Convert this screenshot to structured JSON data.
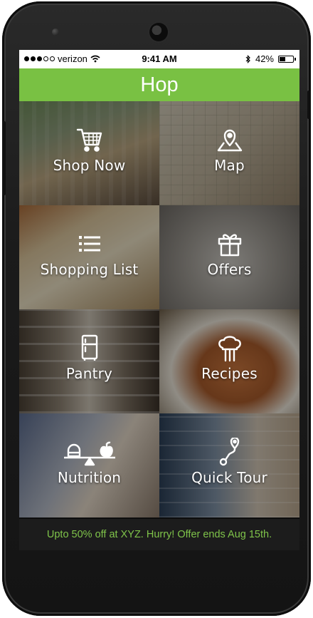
{
  "status_bar": {
    "carrier": "verizon",
    "signal_dots_filled": 3,
    "signal_dots_total": 5,
    "time": "9:41 AM",
    "battery_percent": "42%",
    "battery_level": 0.42
  },
  "header": {
    "title": "Hop"
  },
  "tiles": [
    {
      "label": "Shop Now",
      "icon": "shopping-cart-icon"
    },
    {
      "label": "Map",
      "icon": "map-pin-icon"
    },
    {
      "label": "Shopping List",
      "icon": "list-icon"
    },
    {
      "label": "Offers",
      "icon": "gift-icon"
    },
    {
      "label": "Pantry",
      "icon": "fridge-icon"
    },
    {
      "label": "Recipes",
      "icon": "chef-hat-icon"
    },
    {
      "label": "Nutrition",
      "icon": "balance-scale-icon"
    },
    {
      "label": "Quick Tour",
      "icon": "route-icon"
    }
  ],
  "promo": {
    "text": "Upto 50% off at XYZ. Hurry! Offer ends Aug 15th."
  },
  "colors": {
    "header_bg": "#79c143",
    "promo_text": "#7fc44a",
    "promo_bg": "#1c1c1c"
  }
}
